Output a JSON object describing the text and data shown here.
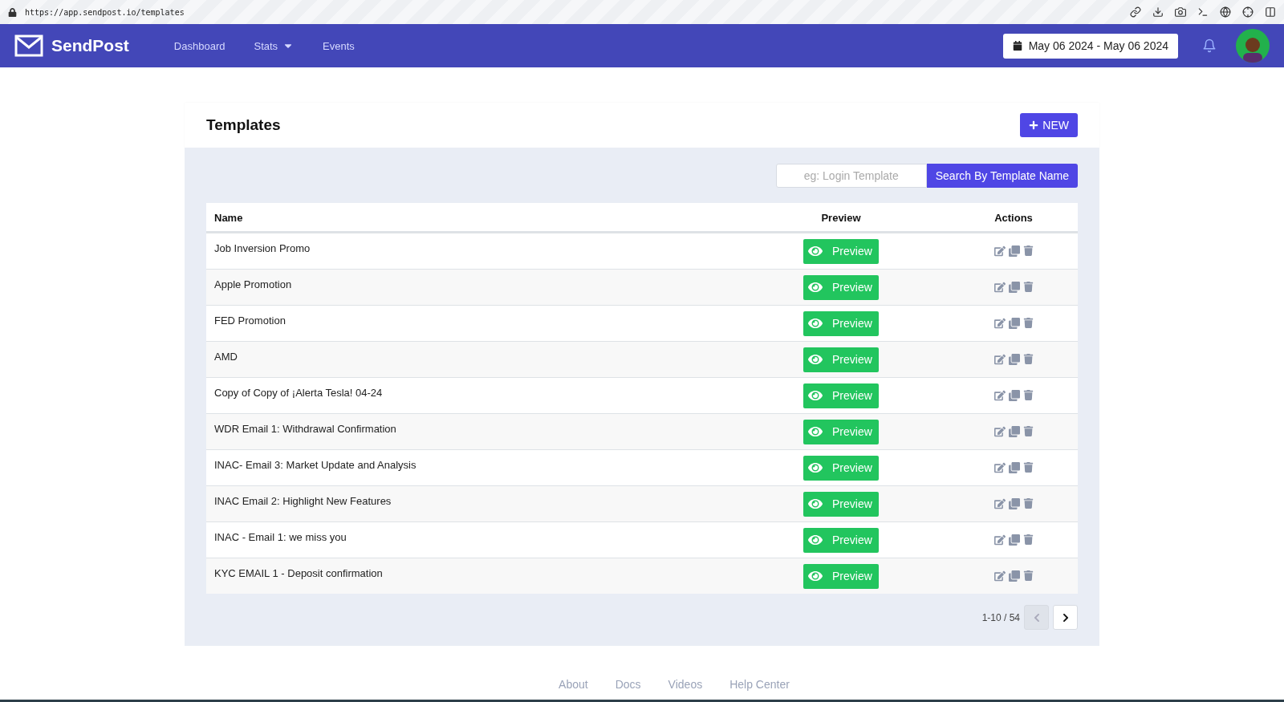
{
  "browser": {
    "url": "https://app.sendpost.io/templates"
  },
  "nav": {
    "brand": "SendPost",
    "links": [
      {
        "label": "Dashboard",
        "dropdown": false
      },
      {
        "label": "Stats",
        "dropdown": true
      },
      {
        "label": "Events",
        "dropdown": false
      }
    ],
    "date_range": "May 06 2024 - May 06 2024"
  },
  "page": {
    "title": "Templates",
    "new_button": "NEW",
    "search": {
      "placeholder": "eg: Login Template",
      "button": "Search By Template Name"
    },
    "table": {
      "columns": [
        "Name",
        "Preview",
        "Actions"
      ],
      "rows": [
        {
          "name": "Job Inversion Promo",
          "preview": "Preview"
        },
        {
          "name": "Apple Promotion",
          "preview": "Preview"
        },
        {
          "name": "FED Promotion",
          "preview": "Preview"
        },
        {
          "name": "AMD",
          "preview": "Preview"
        },
        {
          "name": "Copy of Copy of ¡Alerta Tesla! 04-24",
          "preview": "Preview"
        },
        {
          "name": "WDR Email 1: Withdrawal Confirmation",
          "preview": "Preview"
        },
        {
          "name": "INAC- Email 3: Market Update and Analysis",
          "preview": "Preview"
        },
        {
          "name": "INAC Email 2: Highlight New Features",
          "preview": "Preview"
        },
        {
          "name": "INAC - Email 1: we miss you",
          "preview": "Preview"
        },
        {
          "name": "KYC EMAIL 1 - Deposit confirmation",
          "preview": "Preview"
        }
      ]
    },
    "pagination": {
      "range": "1-10 / 54",
      "prev": {
        "disabled": true
      },
      "next": {
        "disabled": false
      }
    }
  },
  "footer": {
    "links": [
      "About",
      "Docs",
      "Videos",
      "Help Center"
    ]
  }
}
